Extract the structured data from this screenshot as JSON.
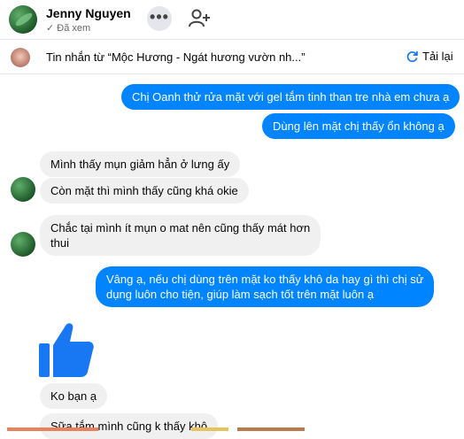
{
  "header": {
    "contact_name": "Jenny Nguyen",
    "seen_status": "✓ Đã xem",
    "more_label": "•••",
    "icons": [
      "more-options-icon",
      "add-person-icon"
    ]
  },
  "forwarded": {
    "text": "Tin nhắn từ  “Mộc Hương - Ngát hương vườn nh...”",
    "reload_label": "Tải lại",
    "icons": [
      "reload-icon"
    ]
  },
  "messages": [
    {
      "side": "out",
      "text": "Chị Oanh thử rửa mặt với gel tắm tinh than tre nhà em chưa ạ"
    },
    {
      "side": "out",
      "text": "Dùng lên mặt chị thấy ổn không ạ"
    },
    {
      "side": "in",
      "text": "Mình thấy mụn giảm hẳn ở lưng ấy"
    },
    {
      "side": "in",
      "text": "Còn mặt thì mình thấy cũng khá okie"
    },
    {
      "side": "in",
      "text": [
        "Chắc tại mình ít mụn o mat nên cũng thấy mát hơn",
        "thui"
      ]
    },
    {
      "side": "out",
      "text": [
        "Vâng ạ, nếu chị dùng trên mặt ko thấy khô da hay gì thì chị sử",
        "dụng luôn cho tiện, giúp làm sạch tốt trên mặt luôn ạ"
      ]
    },
    {
      "side": "in",
      "text": "Ko bạn ạ"
    },
    {
      "side": "in",
      "text": "Sữa tắm mình cũng k thấy khô"
    }
  ],
  "thumbs_up_icon": "like-icon",
  "colors": {
    "outgoing": "#0084ff",
    "incoming": "#f0f0f0",
    "accent": "#1877f2"
  }
}
